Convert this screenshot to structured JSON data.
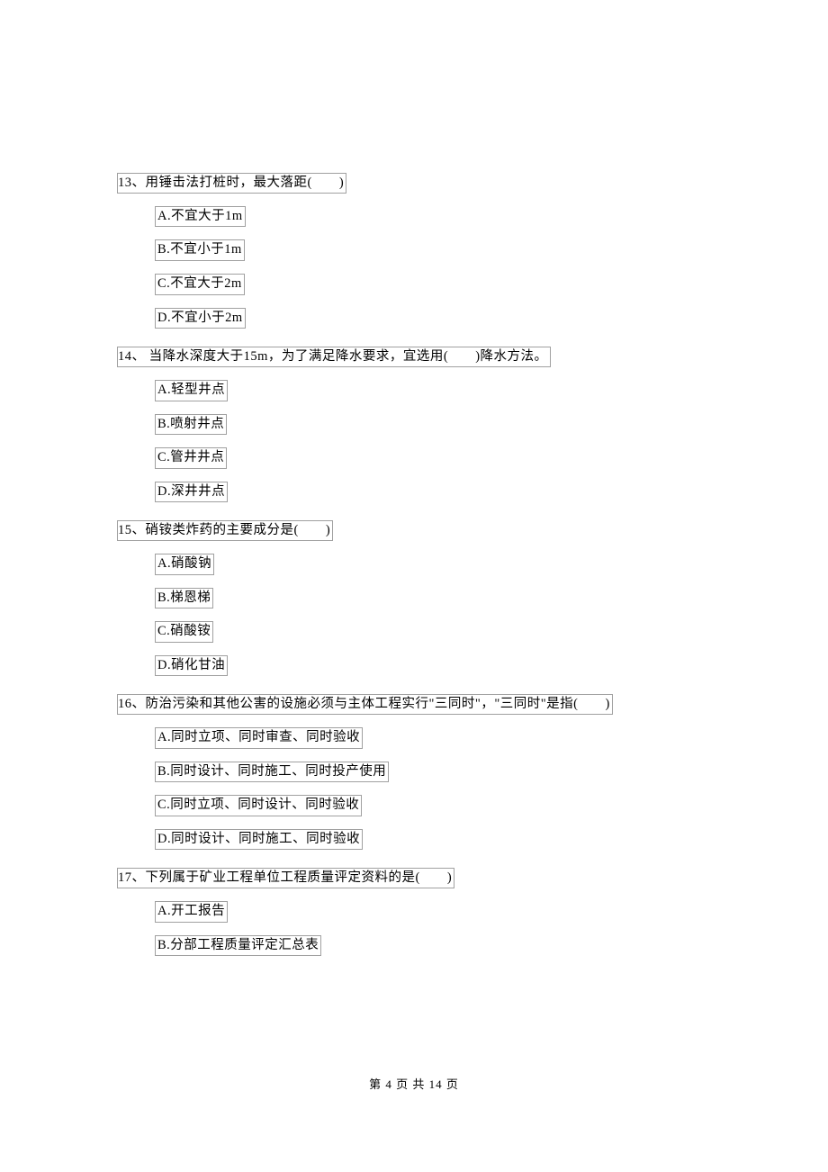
{
  "questions": [
    {
      "number": "13、",
      "text": "用锤击法打桩时，最大落距(　　)",
      "options": [
        "A.不宜大于1m",
        "B.不宜小于1m",
        "C.不宜大于2m",
        "D.不宜小于2m"
      ]
    },
    {
      "number": "14、",
      "text": " 当降水深度大于15m，为了满足降水要求，宜选用(　　)降水方法。",
      "options": [
        "A.轻型井点",
        "B.喷射井点",
        "C.管井井点",
        "D.深井井点"
      ]
    },
    {
      "number": "15、",
      "text": "硝铵类炸药的主要成分是(　　)",
      "options": [
        "A.硝酸钠",
        "B.梯恩梯",
        "C.硝酸铵",
        "D.硝化甘油"
      ]
    },
    {
      "number": "16、",
      "text": "防治污染和其他公害的设施必须与主体工程实行\"三同时\"，\"三同时\"是指(　　)",
      "options": [
        "A.同时立项、同时审查、同时验收",
        "B.同时设计、同时施工、同时投产使用",
        "C.同时立项、同时设计、同时验收",
        "D.同时设计、同时施工、同时验收"
      ]
    },
    {
      "number": "17、",
      "text": "下列属于矿业工程单位工程质量评定资料的是(　　)",
      "options": [
        "A.开工报告",
        "B.分部工程质量评定汇总表"
      ]
    }
  ],
  "footer": "第 4 页 共 14 页"
}
